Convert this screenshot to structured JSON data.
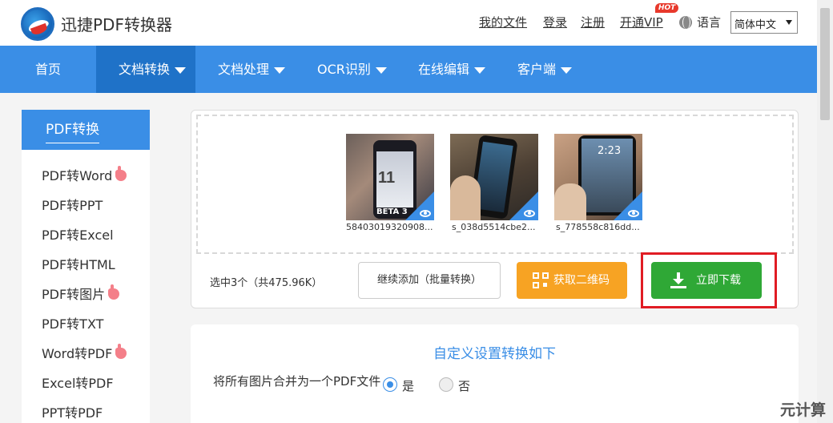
{
  "header": {
    "app_title": "迅捷PDF转换器",
    "links": [
      "我的文件",
      "登录",
      "注册",
      "开通VIP"
    ],
    "hot_badge": "HOT",
    "language_label": "语言",
    "language_selected": "简体中文"
  },
  "nav": {
    "items": [
      {
        "label": "首页"
      },
      {
        "label": "文档转换"
      },
      {
        "label": "文档处理"
      },
      {
        "label": "OCR识别"
      },
      {
        "label": "在线编辑"
      },
      {
        "label": "客户端"
      }
    ]
  },
  "sidebar": {
    "title": "PDF转换",
    "items": [
      {
        "label": "PDF转Word",
        "hot": true
      },
      {
        "label": "PDF转PPT",
        "hot": false
      },
      {
        "label": "PDF转Excel",
        "hot": false
      },
      {
        "label": "PDF转HTML",
        "hot": false
      },
      {
        "label": "PDF转图片",
        "hot": true
      },
      {
        "label": "PDF转TXT",
        "hot": false
      },
      {
        "label": "Word转PDF",
        "hot": true
      },
      {
        "label": "Excel转PDF",
        "hot": false
      },
      {
        "label": "PPT转PDF",
        "hot": false
      }
    ]
  },
  "upload": {
    "files": [
      {
        "name": "58403019320908...",
        "overlay": "11",
        "badge": "BETA 3"
      },
      {
        "name": "s_038d5514cbe2...",
        "overlay": "",
        "badge": ""
      },
      {
        "name": "s_778558c816dd...",
        "overlay": "2:23",
        "badge": ""
      }
    ],
    "summary": "选中3个（共475.96K）",
    "continue_label": "继续添加（批量转换）",
    "qr_label": "获取二维码",
    "download_label": "立即下载"
  },
  "settings": {
    "title": "自定义设置转换如下",
    "merge_label": "将所有图片合并为一个PDF文件",
    "option_yes": "是",
    "option_no": "否",
    "selected": "是"
  },
  "watermark": "元计算",
  "colors": {
    "primary": "#3a8ee6",
    "nav_active": "#1f72c8",
    "qr_button": "#f7a323",
    "download_button": "#2fa836",
    "highlight": "#e01c24"
  }
}
